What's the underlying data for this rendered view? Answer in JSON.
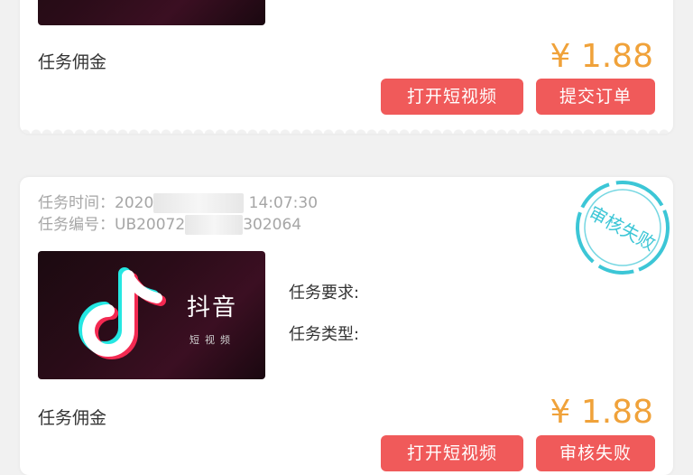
{
  "task1": {
    "commission_label": "任务佣金",
    "price": "¥ 1.88",
    "buttons": {
      "open_video": "打开短视频",
      "submit_order": "提交订单"
    }
  },
  "task2": {
    "time_label": "任务时间：",
    "time_visible_start": "2020",
    "time_visible_end": "14:07:30",
    "id_label": "任务编号：",
    "id_visible_start": "UB20072",
    "id_visible_end": "302064",
    "thumbnail": {
      "brand": "抖音",
      "sub": "短视频",
      "icon": "tiktok-note-icon"
    },
    "requirement_label": "任务要求:",
    "type_label": "任务类型:",
    "stamp_text": "审核失败",
    "commission_label": "任务佣金",
    "price": "¥ 1.88",
    "buttons": {
      "open_video": "打开短视频",
      "status": "审核失败"
    }
  },
  "colors": {
    "accent_button": "#f05a5a",
    "price": "#f0a23a",
    "stamp": "#3cc6d6",
    "background": "#f1f1f1"
  }
}
